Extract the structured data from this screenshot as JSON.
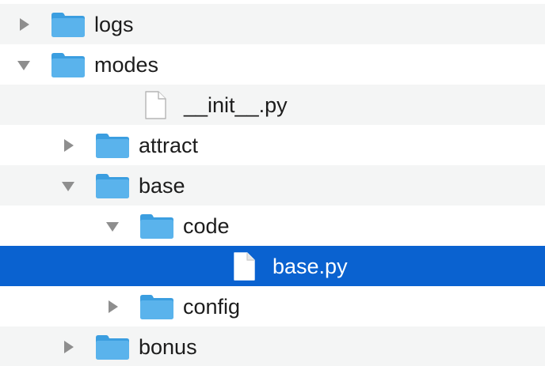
{
  "colors": {
    "selection": "#0a62d0",
    "folder": "#5ab3ec",
    "folder_tab": "#3b9ee0",
    "alt_row": "#f4f5f5",
    "text": "#1c1c1c",
    "disclosure": "#8e8e8e"
  },
  "tree": {
    "items": [
      {
        "label": "logs",
        "kind": "folder",
        "depth": 0,
        "state": "collapsed",
        "selected": false,
        "icon": "folder-icon"
      },
      {
        "label": "modes",
        "kind": "folder",
        "depth": 0,
        "state": "expanded",
        "selected": false,
        "icon": "folder-icon"
      },
      {
        "label": "__init__.py",
        "kind": "file",
        "depth": 1,
        "state": "none",
        "selected": false,
        "icon": "file-icon"
      },
      {
        "label": "attract",
        "kind": "folder",
        "depth": 1,
        "state": "collapsed",
        "selected": false,
        "icon": "folder-icon"
      },
      {
        "label": "base",
        "kind": "folder",
        "depth": 1,
        "state": "expanded",
        "selected": false,
        "icon": "folder-icon"
      },
      {
        "label": "code",
        "kind": "folder",
        "depth": 2,
        "state": "expanded",
        "selected": false,
        "icon": "folder-icon"
      },
      {
        "label": "base.py",
        "kind": "file",
        "depth": 3,
        "state": "none",
        "selected": true,
        "icon": "file-icon"
      },
      {
        "label": "config",
        "kind": "folder",
        "depth": 2,
        "state": "collapsed",
        "selected": false,
        "icon": "folder-icon"
      },
      {
        "label": "bonus",
        "kind": "folder",
        "depth": 1,
        "state": "collapsed",
        "selected": false,
        "icon": "folder-icon"
      }
    ]
  }
}
